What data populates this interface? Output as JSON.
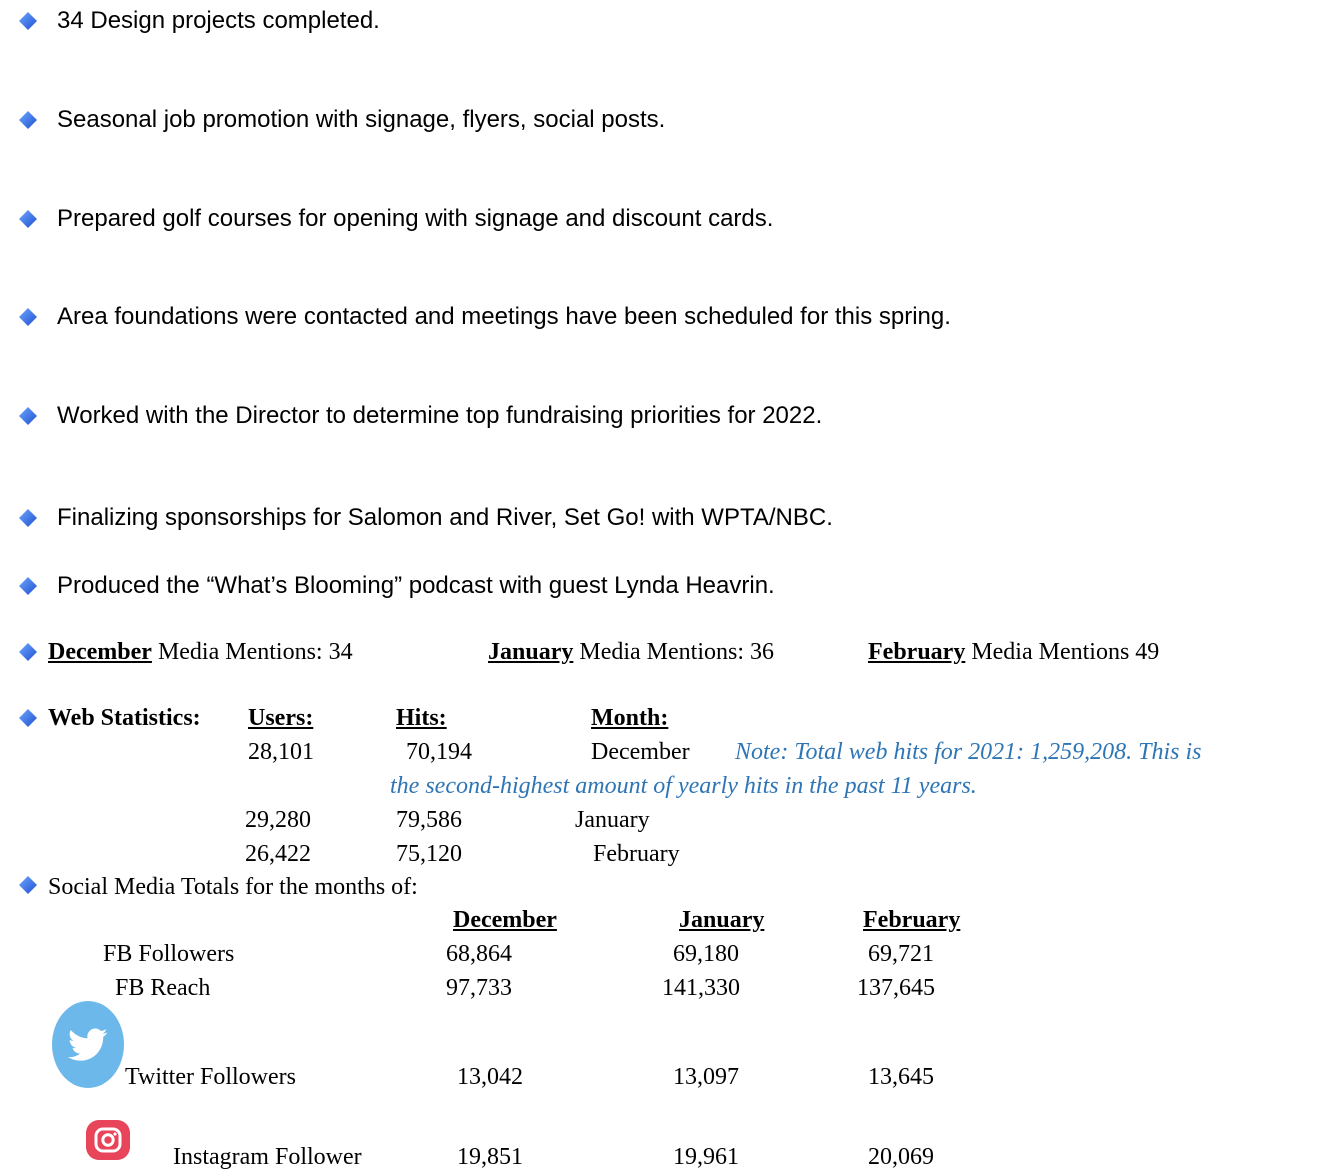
{
  "bullets": [
    "34 Design projects completed.",
    "Seasonal job promotion with signage, flyers, social posts.",
    "Prepared golf courses for opening with signage and discount cards.",
    "Area foundations were contacted and meetings have been scheduled for this spring.",
    "Worked with the Director to determine top fundraising priorities for 2022.",
    "Finalizing sponsorships for Salomon and River, Set Go! with WPTA/NBC.",
    "Produced the “What’s Blooming” podcast with guest Lynda Heavrin."
  ],
  "media_mentions": {
    "dec_month": "December",
    "dec_label": "Media Mentions: 34",
    "jan_month": "January",
    "jan_label": "Media Mentions: 36",
    "feb_month": "February",
    "feb_label": "Media Mentions  49"
  },
  "web_stats": {
    "title": "Web Statistics:",
    "col_users": "Users:",
    "col_hits": "Hits:",
    "col_month": "Month:",
    "rows": [
      {
        "users": "28,101",
        "hits": "70,194",
        "month": "December"
      },
      {
        "users": "29,280",
        "hits": "79,586",
        "month": "January"
      },
      {
        "users": "26,422",
        "hits": "75,120",
        "month": "February"
      }
    ],
    "note_line1": "Note: Total web hits for 2021:  1,259,208.  This is",
    "note_line2": "the second-highest amount of yearly hits in the past 11 years."
  },
  "social": {
    "title": "Social Media Totals for the months of:",
    "headers": [
      "December",
      "January",
      "February"
    ],
    "rows": [
      {
        "label": "FB Followers",
        "values": [
          "68,864",
          "69,180",
          "69,721"
        ]
      },
      {
        "label": "FB Reach",
        "values": [
          "97,733",
          "141,330",
          "137,645"
        ]
      },
      {
        "label": "Twitter Followers",
        "values": [
          "13,042",
          "13,097",
          "13,645"
        ]
      },
      {
        "label": "Instagram Follower",
        "values": [
          "19,851",
          "19,961",
          "20,069"
        ]
      }
    ]
  },
  "icons": {
    "bullet": "diamond-bullet-icon",
    "twitter": "twitter-icon",
    "instagram": "instagram-icon"
  },
  "colors": {
    "bullet_blue": "#1F5FE0",
    "note_blue": "#2E75B6",
    "twitter_blue": "#6CB8EA",
    "instagram_red": "#E8445A"
  }
}
